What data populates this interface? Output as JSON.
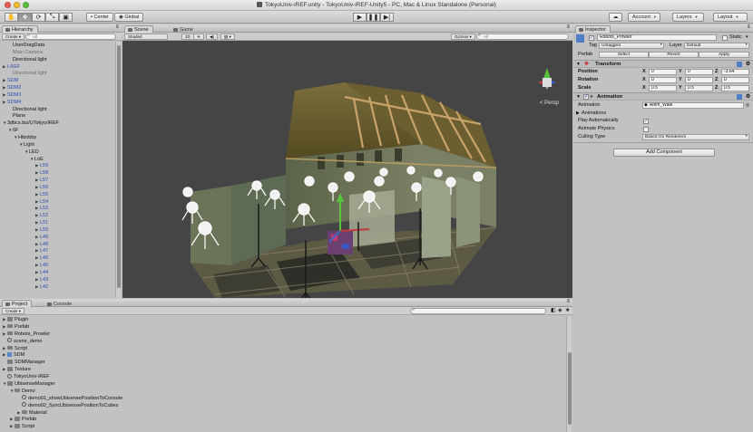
{
  "window": {
    "title": "TokyoUniv-iREF.unity - TokyoUniv-iREF-Unity5 - PC, Mac & Linux Standalone (Personal)"
  },
  "toolbar": {
    "tools": [
      {
        "name": "hand-tool",
        "glyph": "✋"
      },
      {
        "name": "move-tool",
        "glyph": "✥"
      },
      {
        "name": "rotate-tool",
        "glyph": "⟳"
      },
      {
        "name": "scale-tool",
        "glyph": "⤡"
      },
      {
        "name": "rect-tool",
        "glyph": "▣"
      }
    ],
    "pivot_label": "Center",
    "space_label": "Global",
    "cloud_glyph": "☁",
    "account_label": "Account",
    "layers_label": "Layers",
    "layout_label": "Layout"
  },
  "hierarchy": {
    "tab_label": "Hierarchy",
    "create_label": "Create",
    "search_placeholder": "All",
    "items": [
      {
        "label": "UserDragData",
        "indent": 1,
        "caret": "",
        "style": "normal"
      },
      {
        "label": "Main Camera",
        "indent": 1,
        "caret": "",
        "style": "grey"
      },
      {
        "label": "Directional light",
        "indent": 1,
        "caret": "",
        "style": "normal"
      },
      {
        "label": "I-REF",
        "indent": 0,
        "caret": "▶",
        "style": "blue"
      },
      {
        "label": "Directional light",
        "indent": 1,
        "caret": "",
        "style": "grey"
      },
      {
        "label": "SDM",
        "indent": 0,
        "caret": "▶",
        "style": "blue"
      },
      {
        "label": "SDM2",
        "indent": 0,
        "caret": "▶",
        "style": "blue"
      },
      {
        "label": "SDM3",
        "indent": 0,
        "caret": "▶",
        "style": "blue"
      },
      {
        "label": "SDM4",
        "indent": 0,
        "caret": "▶",
        "style": "blue"
      },
      {
        "label": "Directional light",
        "indent": 1,
        "caret": "",
        "style": "normal"
      },
      {
        "label": "Plane",
        "indent": 1,
        "caret": "",
        "style": "normal"
      },
      {
        "label": "3dbcs.biz/UTokyo/iREF",
        "indent": 0,
        "caret": "▼",
        "style": "normal"
      },
      {
        "label": "6F",
        "indent": 1,
        "caret": "▼",
        "style": "normal"
      },
      {
        "label": "Hibobby",
        "indent": 2,
        "caret": "▼",
        "style": "normal"
      },
      {
        "label": "Light",
        "indent": 3,
        "caret": "▼",
        "style": "normal"
      },
      {
        "label": "LED",
        "indent": 4,
        "caret": "▼",
        "style": "normal"
      },
      {
        "label": "LoE",
        "indent": 5,
        "caret": "▼",
        "style": "normal"
      },
      {
        "label": "L59",
        "indent": 6,
        "caret": "▶",
        "style": "blue"
      },
      {
        "label": "L58",
        "indent": 6,
        "caret": "▶",
        "style": "blue"
      },
      {
        "label": "L57",
        "indent": 6,
        "caret": "▶",
        "style": "blue"
      },
      {
        "label": "L56",
        "indent": 6,
        "caret": "▶",
        "style": "blue"
      },
      {
        "label": "L55",
        "indent": 6,
        "caret": "▶",
        "style": "blue"
      },
      {
        "label": "L54",
        "indent": 6,
        "caret": "▶",
        "style": "blue"
      },
      {
        "label": "L53",
        "indent": 6,
        "caret": "▶",
        "style": "blue"
      },
      {
        "label": "L52",
        "indent": 6,
        "caret": "▶",
        "style": "blue"
      },
      {
        "label": "L51",
        "indent": 6,
        "caret": "▶",
        "style": "blue"
      },
      {
        "label": "L50",
        "indent": 6,
        "caret": "▶",
        "style": "blue"
      },
      {
        "label": "L49",
        "indent": 6,
        "caret": "▶",
        "style": "blue"
      },
      {
        "label": "L48",
        "indent": 6,
        "caret": "▶",
        "style": "blue"
      },
      {
        "label": "L47",
        "indent": 6,
        "caret": "▶",
        "style": "blue"
      },
      {
        "label": "L46",
        "indent": 6,
        "caret": "▶",
        "style": "blue"
      },
      {
        "label": "L45",
        "indent": 6,
        "caret": "▶",
        "style": "blue"
      },
      {
        "label": "L44",
        "indent": 6,
        "caret": "▶",
        "style": "blue"
      },
      {
        "label": "L43",
        "indent": 6,
        "caret": "▶",
        "style": "blue"
      },
      {
        "label": "L42",
        "indent": 6,
        "caret": "▶",
        "style": "blue"
      },
      {
        "label": "",
        "indent": 0,
        "caret": "",
        "style": "normal"
      },
      {
        "label": "Air",
        "indent": 3,
        "caret": "▶",
        "style": "normal"
      }
    ]
  },
  "scene": {
    "tab_scene": "Scene",
    "tab_game": "Game",
    "shading_label": "Shaded",
    "mode_2d_label": "2D",
    "gizmos_label": "Gizmos",
    "search_placeholder": "All",
    "persp_label": "< Persp"
  },
  "inspector": {
    "tab_label": "Inspector",
    "object_name": "Robots_Prowler",
    "static_label": "Static",
    "tag_label": "Tag",
    "tag_value": "Untagged",
    "layer_label": "Layer",
    "layer_value": "Default",
    "prefab_label": "Prefab",
    "prefab_select": "Select",
    "prefab_revert": "Revert",
    "prefab_apply": "Apply",
    "transform": {
      "title": "Transform",
      "rows": [
        {
          "label": "Position",
          "x": "0",
          "y": "0",
          "z": "-3.64"
        },
        {
          "label": "Rotation",
          "x": "0",
          "y": "0",
          "z": "0"
        },
        {
          "label": "Scale",
          "x": "0.5",
          "y": "0.5",
          "z": "0.5"
        }
      ]
    },
    "animation": {
      "title": "Animation",
      "animation_label": "Animation",
      "animation_value": "Anim_Walk",
      "animations_label": "Animations",
      "play_auto_label": "Play Automatically",
      "play_auto_checked": true,
      "animate_physics_label": "Animate Physics",
      "animate_physics_checked": false,
      "culling_label": "Culling Type",
      "culling_value": "Based On Renderers"
    },
    "add_component_label": "Add Component"
  },
  "project": {
    "tab_project": "Project",
    "tab_console": "Console",
    "create_label": "Create",
    "items": [
      {
        "label": "Plugin",
        "indent": 0,
        "caret": "▶",
        "icon": "folder"
      },
      {
        "label": "Prefab",
        "indent": 0,
        "caret": "▶",
        "icon": "folder"
      },
      {
        "label": "Robots_Prowler",
        "indent": 0,
        "caret": "▶",
        "icon": "folder"
      },
      {
        "label": "scene_demo",
        "indent": 0,
        "caret": "",
        "icon": "scene"
      },
      {
        "label": "Script",
        "indent": 0,
        "caret": "▶",
        "icon": "folder"
      },
      {
        "label": "SDM",
        "indent": 0,
        "caret": "▶",
        "icon": "prefab"
      },
      {
        "label": "SDMManager",
        "indent": 0,
        "caret": "",
        "icon": "folder"
      },
      {
        "label": "Texture",
        "indent": 0,
        "caret": "▶",
        "icon": "folder"
      },
      {
        "label": "TokyoUniv-iREF",
        "indent": 0,
        "caret": "",
        "icon": "scene"
      },
      {
        "label": "UbisenseManager",
        "indent": 0,
        "caret": "▼",
        "icon": "folder"
      },
      {
        "label": "Demo",
        "indent": 1,
        "caret": "▼",
        "icon": "folder"
      },
      {
        "label": "demo01_showUbisensePositionToConsole",
        "indent": 2,
        "caret": "",
        "icon": "scene"
      },
      {
        "label": "demo02_SyncUbisensePositionToCubes",
        "indent": 2,
        "caret": "",
        "icon": "scene"
      },
      {
        "label": "Material",
        "indent": 2,
        "caret": "▶",
        "icon": "folder"
      },
      {
        "label": "Prefab",
        "indent": 1,
        "caret": "▶",
        "icon": "folder"
      },
      {
        "label": "Script",
        "indent": 1,
        "caret": "▶",
        "icon": "folder"
      }
    ]
  }
}
